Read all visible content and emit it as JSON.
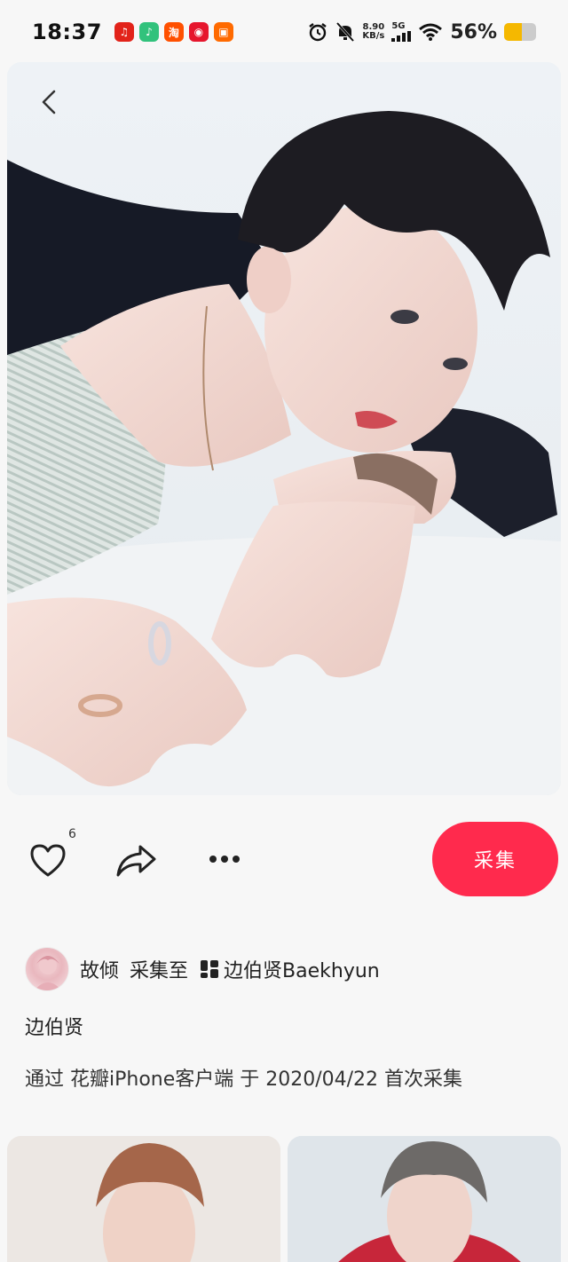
{
  "status_bar": {
    "time": "18:37",
    "speed_value": "8.90",
    "speed_unit": "KB/s",
    "network": "5G",
    "battery": "56%",
    "battery_level": 0.56
  },
  "app_icons": [
    {
      "name": "netease-music-icon",
      "color": "#e2231a"
    },
    {
      "name": "qq-music-icon",
      "color": "#31c27c"
    },
    {
      "name": "taobao-icon",
      "color": "#ff5000"
    },
    {
      "name": "weibo-icon",
      "color": "#e6162d"
    },
    {
      "name": "shop-icon",
      "color": "#ff6a00"
    }
  ],
  "actions": {
    "like_count": "6",
    "collect_label": "采集"
  },
  "pin": {
    "user": "故倾",
    "collect_to": "采集至",
    "board": "边伯贤Baekhyun",
    "title": "边伯贤",
    "source": "通过 花瓣iPhone客户端 于 2020/04/22 首次采集"
  },
  "colors": {
    "accent": "#ff2a4d"
  }
}
